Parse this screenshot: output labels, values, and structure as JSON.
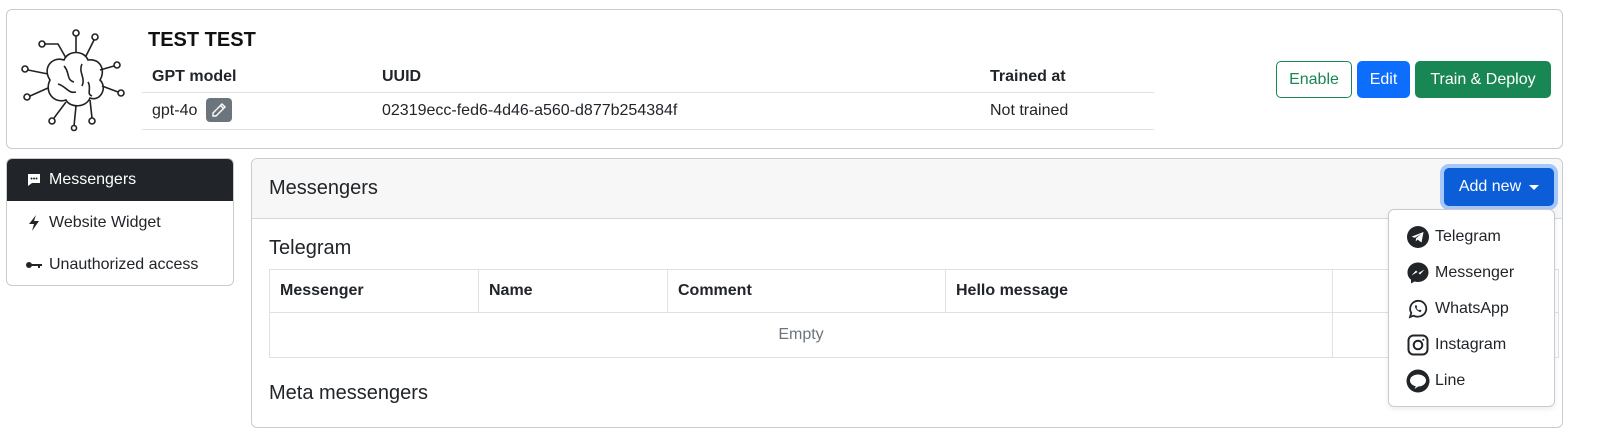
{
  "bot": {
    "title": "TEST TEST",
    "headers": {
      "model": "GPT model",
      "uuid": "UUID",
      "trained": "Trained at"
    },
    "model": "gpt-4o",
    "uuid": "02319ecc-fed6-4d46-a560-d877b254384f",
    "trained": "Not trained"
  },
  "actions": {
    "enable": "Enable",
    "edit": "Edit",
    "train": "Train & Deploy"
  },
  "sidebar": {
    "items": [
      {
        "label": "Messengers",
        "icon": "chat-dots-icon",
        "active": true
      },
      {
        "label": "Website Widget",
        "icon": "lightning-icon"
      },
      {
        "label": "Unauthorized access",
        "icon": "key-icon"
      }
    ]
  },
  "panel": {
    "title": "Messengers",
    "add_new": "Add new",
    "telegram_title": "Telegram",
    "columns": [
      "Messenger",
      "Name",
      "Comment",
      "Hello message",
      ""
    ],
    "empty": "Empty",
    "meta_title": "Meta messengers"
  },
  "dropdown": {
    "items": [
      {
        "label": "Telegram",
        "icon": "telegram-icon"
      },
      {
        "label": "Messenger",
        "icon": "messenger-icon"
      },
      {
        "label": "WhatsApp",
        "icon": "whatsapp-icon"
      },
      {
        "label": "Instagram",
        "icon": "instagram-icon"
      },
      {
        "label": "Line",
        "icon": "line-icon"
      }
    ]
  },
  "colors": {
    "primary": "#0d6efd",
    "success": "#198754",
    "dark": "#212529",
    "secondary": "#6c757d"
  }
}
